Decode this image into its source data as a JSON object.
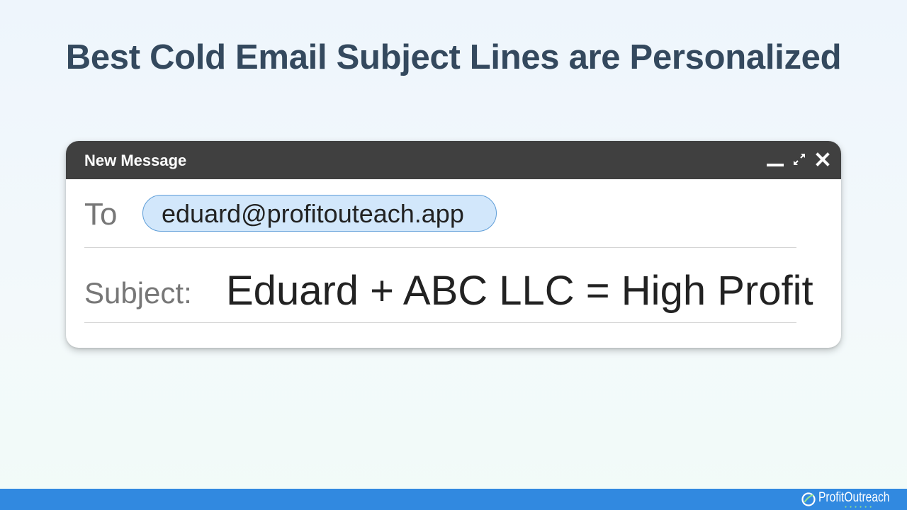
{
  "page": {
    "title": "Best Cold Email Subject Lines are Personalized"
  },
  "compose": {
    "window_title": "New Message",
    "header_icons": [
      "minimize-icon",
      "expand-icon",
      "close-icon"
    ],
    "to_label": "To",
    "recipient": "eduard@profitouteach.app",
    "subject_label": "Subject:",
    "subject_value": "Eduard + ABC LLC = High Profit"
  },
  "footer": {
    "brand": "ProfitOutreach"
  },
  "colors": {
    "title": "#34495e",
    "header_bg": "#404040",
    "chip_bg": "#d2e7fb",
    "chip_border": "#5f9ed8",
    "footer_bar": "#3189e0"
  }
}
